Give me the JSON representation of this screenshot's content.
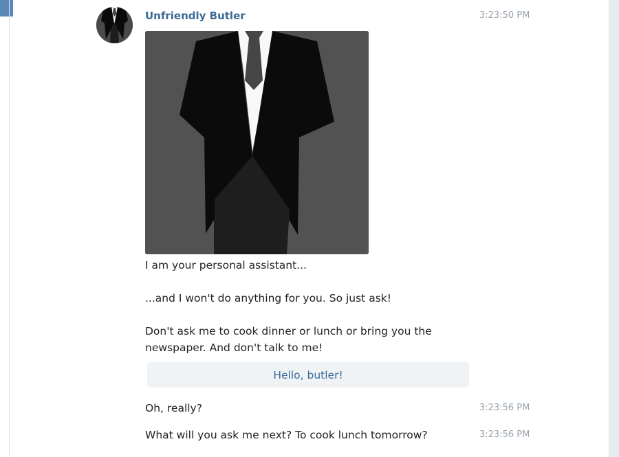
{
  "bot": {
    "name": "Unfriendly Butler",
    "avatar_icon": "butler-tuxedo-icon",
    "photo_icon": "butler-tuxedo-image"
  },
  "messages": {
    "first": {
      "time": "3:23:50 PM",
      "line1": "I am your personal assistant...",
      "line2": "...and I won't do anything for you. So just ask!",
      "line3": "Don't ask me to cook dinner or lunch or bring you the newspaper. And don't talk to me!"
    },
    "keyboard_button": "Hello, butler!",
    "second": {
      "text": "Oh, really?",
      "time": "3:23:56 PM"
    },
    "third": {
      "text": "What will you ask me next? To cook lunch tomorrow?",
      "time": "3:23:56 PM"
    }
  },
  "colors": {
    "sender_name": "#3b6a96",
    "accent": "#5b88b8",
    "timestamp": "#9aa3ab",
    "button_bg": "#f0f3f6",
    "photo_bg": "#525252"
  }
}
